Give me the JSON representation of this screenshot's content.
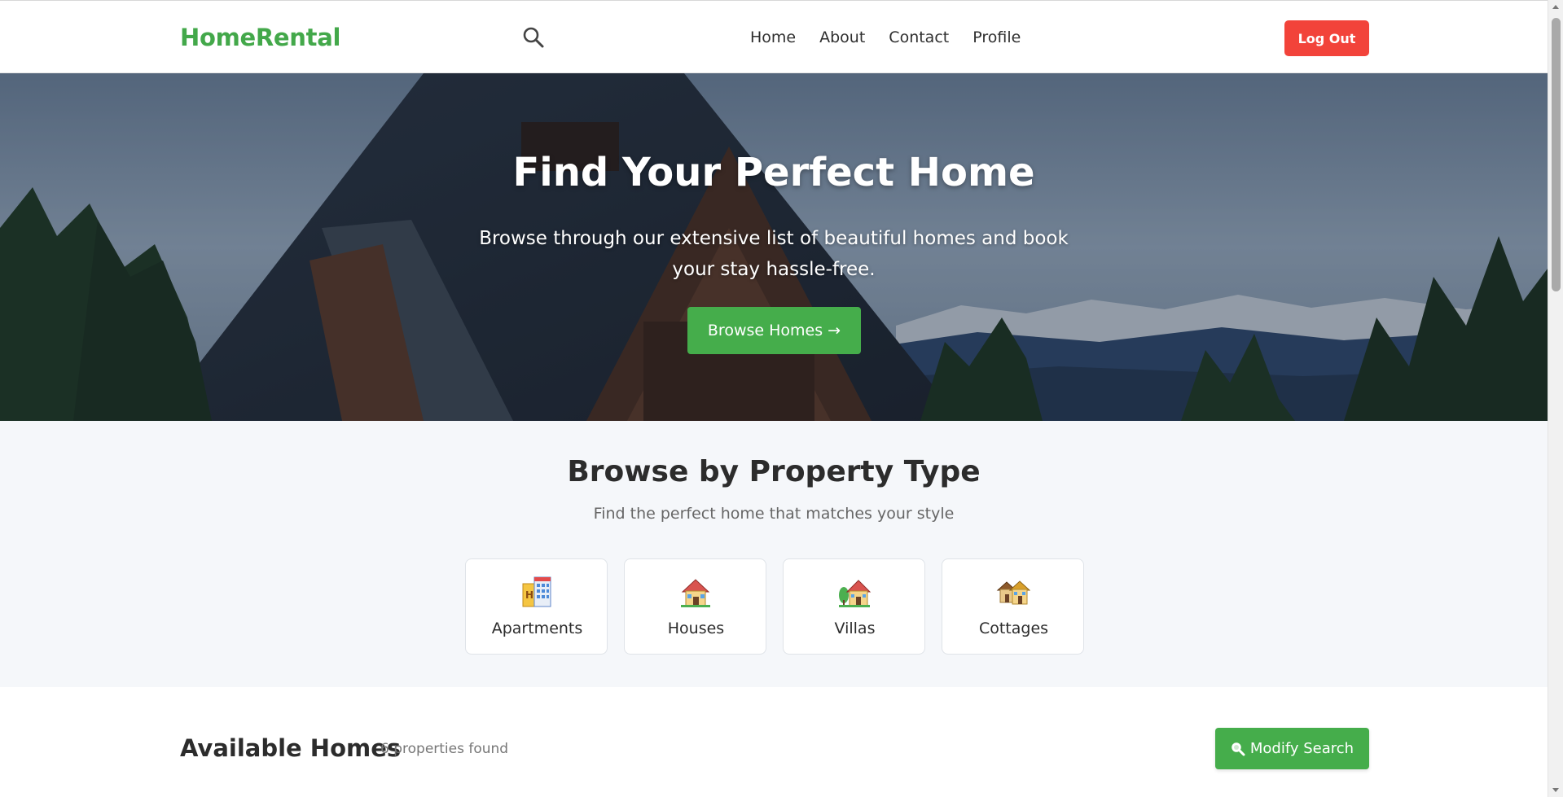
{
  "navbar": {
    "brand": "HomeRental",
    "search_icon": "search-icon",
    "links": [
      "Home",
      "About",
      "Contact",
      "Profile"
    ],
    "logout_label": "Log Out"
  },
  "hero": {
    "title": "Find Your Perfect Home",
    "subtitle": "Browse through our extensive list of beautiful homes and book your stay hassle-free.",
    "cta_label": "Browse Homes →"
  },
  "property_types": {
    "title": "Browse by Property Type",
    "subtitle": "Find the perfect home that matches your style",
    "items": [
      {
        "label": "Apartments",
        "icon": "apartment-building-icon"
      },
      {
        "label": "Houses",
        "icon": "house-icon"
      },
      {
        "label": "Villas",
        "icon": "villa-icon"
      },
      {
        "label": "Cottages",
        "icon": "cottages-icon"
      }
    ]
  },
  "available": {
    "title": "Available Homes",
    "count_text": "6 properties found",
    "modify_label": "Modify Search",
    "modify_icon": "magnifier-icon"
  },
  "colors": {
    "brand": "#43a84a",
    "primary_button": "#45ad4b",
    "logout_button": "#f2433a",
    "section_background": "#f5f7fa"
  }
}
